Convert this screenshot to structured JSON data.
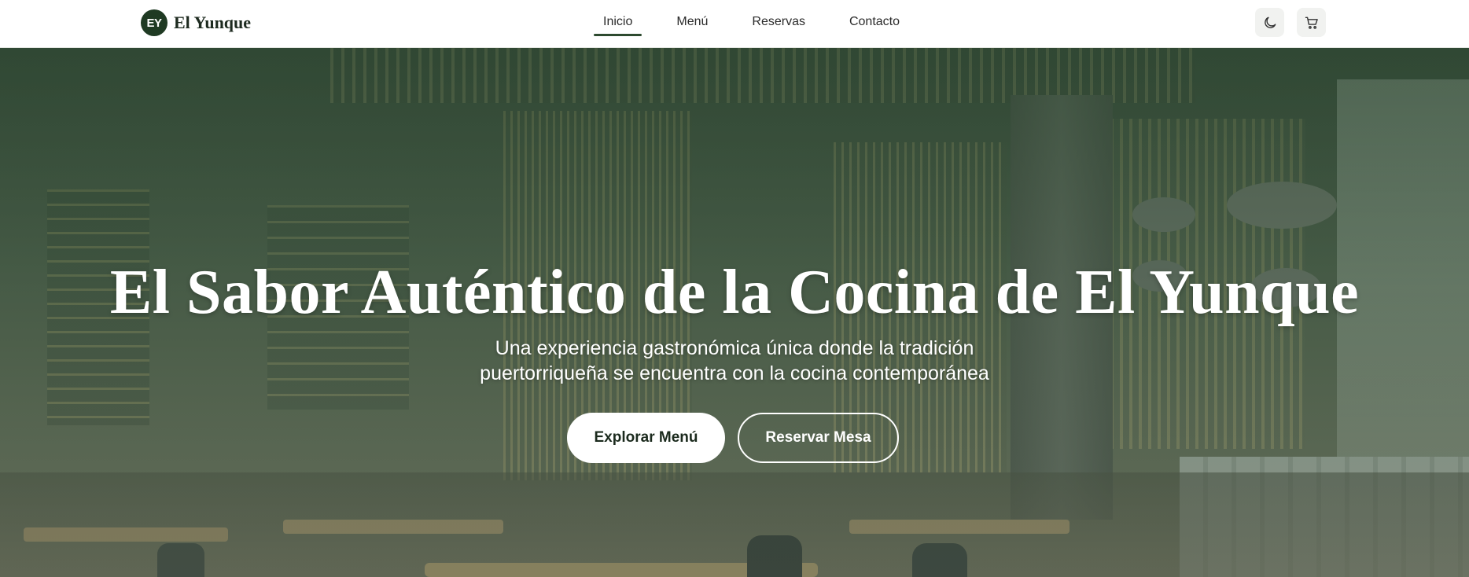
{
  "brand": {
    "badge": "EY",
    "name": "El Yunque"
  },
  "nav": {
    "items": [
      {
        "label": "Inicio",
        "active": true
      },
      {
        "label": "Menú",
        "active": false
      },
      {
        "label": "Reservas",
        "active": false
      },
      {
        "label": "Contacto",
        "active": false
      }
    ]
  },
  "actions": {
    "theme_icon": "moon-icon",
    "cart_icon": "cart-icon"
  },
  "hero": {
    "title": "El Sabor Auténtico de la Cocina de El Yunque",
    "subtitle_line1": "Una experiencia gastronómica única donde la tradición",
    "subtitle_line2": "puertorriqueña se encuentra con la cocina contemporánea",
    "primary_button": "Explorar Menú",
    "secondary_button": "Reservar Mesa"
  },
  "colors": {
    "brand": "#1f3a23",
    "accent": "#2d4a2f"
  }
}
